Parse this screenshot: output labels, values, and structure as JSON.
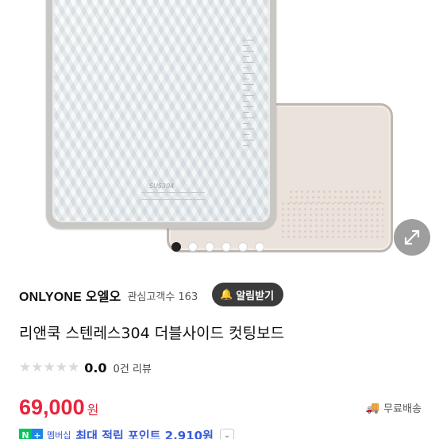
{
  "product_image": {
    "engraving": "SUS304",
    "carousel": {
      "total_slides": 6,
      "active_index": 0
    }
  },
  "store": {
    "name": "ONLYONE 오엘오",
    "followers_label": "관심고객수 163",
    "alarm_label": "알림받기"
  },
  "product": {
    "title": "리앤쿡 스텐레스304 더블사이드 컷팅보드",
    "rating": {
      "stars_filled": 0,
      "stars_total": 5,
      "score": "0.0",
      "reviews_label": "0건 리뷰"
    },
    "price": "69,000",
    "currency": "원",
    "shipping_label": "무료배송"
  },
  "points": {
    "badge_n": "N",
    "badge_plus": "+",
    "member_label": "멤버십",
    "text": "최대 적립 포인트 2,910원"
  },
  "colors": {
    "price_red": "#e8253d",
    "point_blue": "#3a5bd9",
    "naver_green": "#03c75a",
    "alarm_button_bg": "#3b3b3b"
  }
}
